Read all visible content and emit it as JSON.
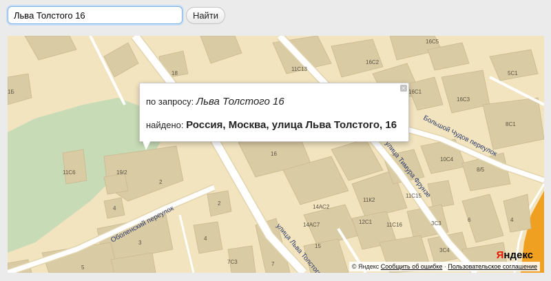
{
  "search": {
    "value": "Льва Толстого 16",
    "button_label": "Найти"
  },
  "balloon": {
    "query_label": "по запросу: ",
    "query_value": "Льва Толстого 16",
    "found_label": "найдено: ",
    "found_value": "Россия, Москва, улица Льва Толстого, 16",
    "close_glyph": "×"
  },
  "map": {
    "streets": {
      "bolshoy_chudov": "Большой Чудов переулок",
      "timura_frunze": "улица Тимура Фрунзе",
      "obolensky": "Оболенский переулок",
      "lva_tolstogo": "улица Льва Толстого"
    },
    "house_numbers": {
      "n18": "18",
      "n1b": "1Б",
      "n11c13": "11С13",
      "n16c2": "16С2",
      "n16c5": "16С5",
      "n5c1": "5С1",
      "n16c1": "16С1",
      "n16c3": "16С3",
      "n8c1": "8С1",
      "n16": "16",
      "n10c4": "10С4",
      "n8_5": "8/5",
      "n11c6": "11С6",
      "n19_2": "19/2",
      "n2a": "2",
      "n2b": "2",
      "n4a": "4",
      "n4b": "4",
      "n14ac2": "14АС2",
      "n11k2": "11К2",
      "n11c15": "11С15",
      "n12c1": "12С1",
      "n11c16": "11С16",
      "n14ac7": "14АС7",
      "n3c3": "3С3",
      "n6": "6",
      "n4c": "4",
      "n3": "3",
      "n15": "15",
      "n3c4": "3С4",
      "n5": "5",
      "n7c3": "7С3",
      "n7": "7"
    }
  },
  "copyright": {
    "text": "© Яндекс",
    "report_error": "Сообщить об ошибке",
    "separator": "·",
    "user_agreement": "Пользовательское соглашение"
  },
  "logo": {
    "first_letter": "Я",
    "rest": "ндекс"
  },
  "colors": {
    "map_background": "#f1e4bf",
    "building": "#d9cba4",
    "park": "#c7dbb6",
    "road": "#ffffff",
    "highway": "#f0a020",
    "street_label": "#2d3a6b",
    "logo_red": "#e61400"
  }
}
